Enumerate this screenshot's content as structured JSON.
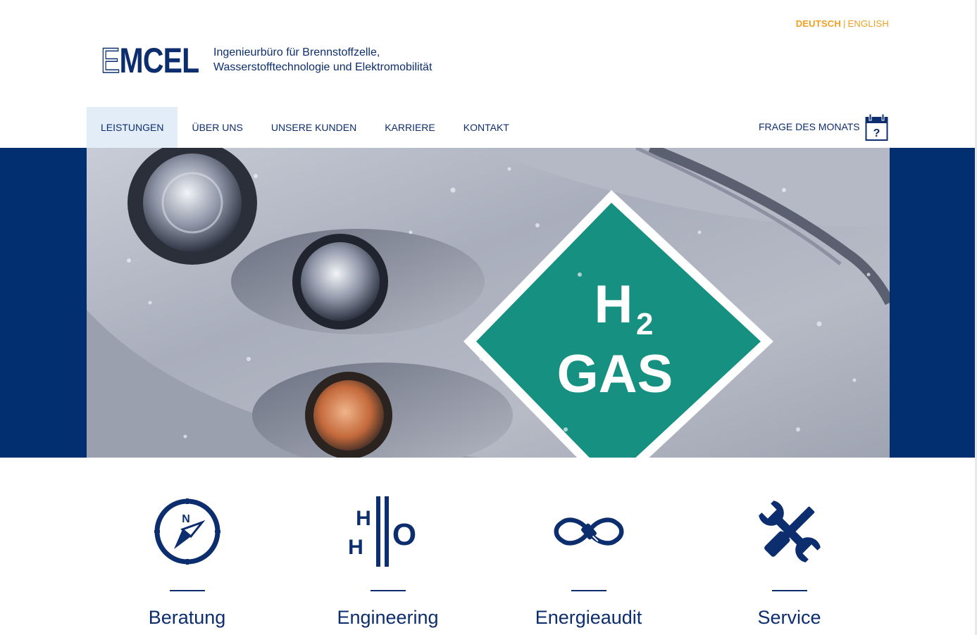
{
  "lang": {
    "active": "DEUTSCH",
    "other": "ENGLISH"
  },
  "logo": {
    "first": "E",
    "rest": "MCEL"
  },
  "tagline": {
    "line1": "Ingenieurbüro für Brennstoffzelle,",
    "line2": "Wasserstofftechnologie und Elektromobilität"
  },
  "nav": {
    "items": [
      {
        "label": "LEISTUNGEN",
        "active": true
      },
      {
        "label": "ÜBER UNS"
      },
      {
        "label": "UNSERE KUNDEN"
      },
      {
        "label": "KARRIERE"
      },
      {
        "label": "KONTAKT"
      }
    ],
    "faq": "FRAGE DES MONATS",
    "calendar_icon": "calendar-question-icon",
    "calendar_mark": "?"
  },
  "hero": {
    "sign_line1": "H",
    "sign_sub": "2",
    "sign_line2": "GAS"
  },
  "features": [
    {
      "label": "Beratung",
      "icon": "compass-icon",
      "compass_letter": "N"
    },
    {
      "label": "Engineering",
      "icon": "h2o-icon",
      "h1": "H",
      "h2": "H",
      "o": "O"
    },
    {
      "label": "Energieaudit",
      "icon": "infinity-plug-icon"
    },
    {
      "label": "Service",
      "icon": "wrench-screwdriver-icon"
    }
  ],
  "colors": {
    "navy": "#0d2e6e",
    "band": "#012f6f",
    "accent": "#f0a020",
    "sign_green": "#169080"
  }
}
